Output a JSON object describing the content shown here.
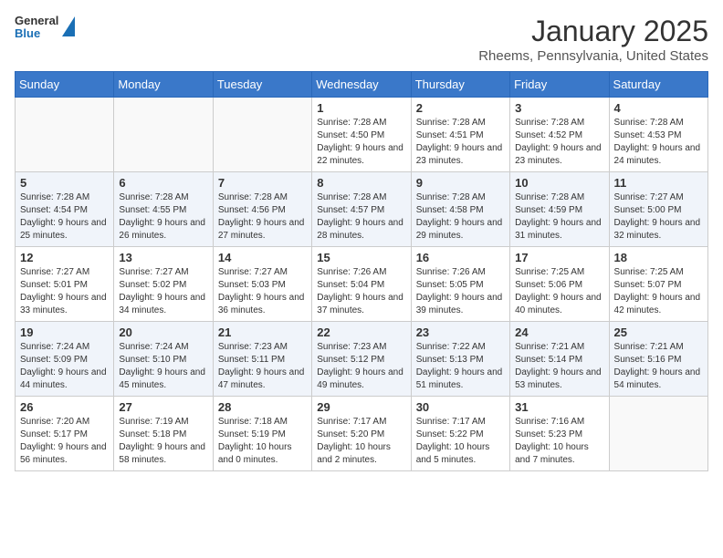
{
  "logo": {
    "general": "General",
    "blue": "Blue"
  },
  "title": "January 2025",
  "subtitle": "Rheems, Pennsylvania, United States",
  "weekdays": [
    "Sunday",
    "Monday",
    "Tuesday",
    "Wednesday",
    "Thursday",
    "Friday",
    "Saturday"
  ],
  "weeks": [
    [
      {
        "day": "",
        "sunrise": "",
        "sunset": "",
        "daylight": ""
      },
      {
        "day": "",
        "sunrise": "",
        "sunset": "",
        "daylight": ""
      },
      {
        "day": "",
        "sunrise": "",
        "sunset": "",
        "daylight": ""
      },
      {
        "day": "1",
        "sunrise": "Sunrise: 7:28 AM",
        "sunset": "Sunset: 4:50 PM",
        "daylight": "Daylight: 9 hours and 22 minutes."
      },
      {
        "day": "2",
        "sunrise": "Sunrise: 7:28 AM",
        "sunset": "Sunset: 4:51 PM",
        "daylight": "Daylight: 9 hours and 23 minutes."
      },
      {
        "day": "3",
        "sunrise": "Sunrise: 7:28 AM",
        "sunset": "Sunset: 4:52 PM",
        "daylight": "Daylight: 9 hours and 23 minutes."
      },
      {
        "day": "4",
        "sunrise": "Sunrise: 7:28 AM",
        "sunset": "Sunset: 4:53 PM",
        "daylight": "Daylight: 9 hours and 24 minutes."
      }
    ],
    [
      {
        "day": "5",
        "sunrise": "Sunrise: 7:28 AM",
        "sunset": "Sunset: 4:54 PM",
        "daylight": "Daylight: 9 hours and 25 minutes."
      },
      {
        "day": "6",
        "sunrise": "Sunrise: 7:28 AM",
        "sunset": "Sunset: 4:55 PM",
        "daylight": "Daylight: 9 hours and 26 minutes."
      },
      {
        "day": "7",
        "sunrise": "Sunrise: 7:28 AM",
        "sunset": "Sunset: 4:56 PM",
        "daylight": "Daylight: 9 hours and 27 minutes."
      },
      {
        "day": "8",
        "sunrise": "Sunrise: 7:28 AM",
        "sunset": "Sunset: 4:57 PM",
        "daylight": "Daylight: 9 hours and 28 minutes."
      },
      {
        "day": "9",
        "sunrise": "Sunrise: 7:28 AM",
        "sunset": "Sunset: 4:58 PM",
        "daylight": "Daylight: 9 hours and 29 minutes."
      },
      {
        "day": "10",
        "sunrise": "Sunrise: 7:28 AM",
        "sunset": "Sunset: 4:59 PM",
        "daylight": "Daylight: 9 hours and 31 minutes."
      },
      {
        "day": "11",
        "sunrise": "Sunrise: 7:27 AM",
        "sunset": "Sunset: 5:00 PM",
        "daylight": "Daylight: 9 hours and 32 minutes."
      }
    ],
    [
      {
        "day": "12",
        "sunrise": "Sunrise: 7:27 AM",
        "sunset": "Sunset: 5:01 PM",
        "daylight": "Daylight: 9 hours and 33 minutes."
      },
      {
        "day": "13",
        "sunrise": "Sunrise: 7:27 AM",
        "sunset": "Sunset: 5:02 PM",
        "daylight": "Daylight: 9 hours and 34 minutes."
      },
      {
        "day": "14",
        "sunrise": "Sunrise: 7:27 AM",
        "sunset": "Sunset: 5:03 PM",
        "daylight": "Daylight: 9 hours and 36 minutes."
      },
      {
        "day": "15",
        "sunrise": "Sunrise: 7:26 AM",
        "sunset": "Sunset: 5:04 PM",
        "daylight": "Daylight: 9 hours and 37 minutes."
      },
      {
        "day": "16",
        "sunrise": "Sunrise: 7:26 AM",
        "sunset": "Sunset: 5:05 PM",
        "daylight": "Daylight: 9 hours and 39 minutes."
      },
      {
        "day": "17",
        "sunrise": "Sunrise: 7:25 AM",
        "sunset": "Sunset: 5:06 PM",
        "daylight": "Daylight: 9 hours and 40 minutes."
      },
      {
        "day": "18",
        "sunrise": "Sunrise: 7:25 AM",
        "sunset": "Sunset: 5:07 PM",
        "daylight": "Daylight: 9 hours and 42 minutes."
      }
    ],
    [
      {
        "day": "19",
        "sunrise": "Sunrise: 7:24 AM",
        "sunset": "Sunset: 5:09 PM",
        "daylight": "Daylight: 9 hours and 44 minutes."
      },
      {
        "day": "20",
        "sunrise": "Sunrise: 7:24 AM",
        "sunset": "Sunset: 5:10 PM",
        "daylight": "Daylight: 9 hours and 45 minutes."
      },
      {
        "day": "21",
        "sunrise": "Sunrise: 7:23 AM",
        "sunset": "Sunset: 5:11 PM",
        "daylight": "Daylight: 9 hours and 47 minutes."
      },
      {
        "day": "22",
        "sunrise": "Sunrise: 7:23 AM",
        "sunset": "Sunset: 5:12 PM",
        "daylight": "Daylight: 9 hours and 49 minutes."
      },
      {
        "day": "23",
        "sunrise": "Sunrise: 7:22 AM",
        "sunset": "Sunset: 5:13 PM",
        "daylight": "Daylight: 9 hours and 51 minutes."
      },
      {
        "day": "24",
        "sunrise": "Sunrise: 7:21 AM",
        "sunset": "Sunset: 5:14 PM",
        "daylight": "Daylight: 9 hours and 53 minutes."
      },
      {
        "day": "25",
        "sunrise": "Sunrise: 7:21 AM",
        "sunset": "Sunset: 5:16 PM",
        "daylight": "Daylight: 9 hours and 54 minutes."
      }
    ],
    [
      {
        "day": "26",
        "sunrise": "Sunrise: 7:20 AM",
        "sunset": "Sunset: 5:17 PM",
        "daylight": "Daylight: 9 hours and 56 minutes."
      },
      {
        "day": "27",
        "sunrise": "Sunrise: 7:19 AM",
        "sunset": "Sunset: 5:18 PM",
        "daylight": "Daylight: 9 hours and 58 minutes."
      },
      {
        "day": "28",
        "sunrise": "Sunrise: 7:18 AM",
        "sunset": "Sunset: 5:19 PM",
        "daylight": "Daylight: 10 hours and 0 minutes."
      },
      {
        "day": "29",
        "sunrise": "Sunrise: 7:17 AM",
        "sunset": "Sunset: 5:20 PM",
        "daylight": "Daylight: 10 hours and 2 minutes."
      },
      {
        "day": "30",
        "sunrise": "Sunrise: 7:17 AM",
        "sunset": "Sunset: 5:22 PM",
        "daylight": "Daylight: 10 hours and 5 minutes."
      },
      {
        "day": "31",
        "sunrise": "Sunrise: 7:16 AM",
        "sunset": "Sunset: 5:23 PM",
        "daylight": "Daylight: 10 hours and 7 minutes."
      },
      {
        "day": "",
        "sunrise": "",
        "sunset": "",
        "daylight": ""
      }
    ]
  ]
}
